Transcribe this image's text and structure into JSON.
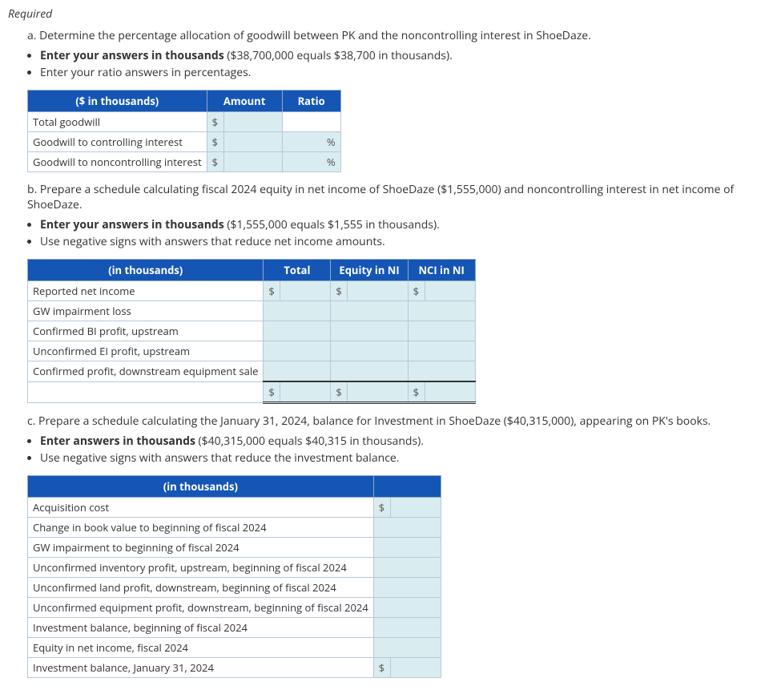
{
  "heading": "Required",
  "parts": {
    "a": {
      "prompt": "a. Determine the percentage allocation of goodwill between PK and the noncontrolling interest in ShoeDaze.",
      "bullets": [
        {
          "bold": "Enter your answers in thousands",
          "rest": " ($38,700,000 equals $38,700 in thousands)."
        },
        {
          "bold": "",
          "rest": "Enter your ratio answers in percentages."
        }
      ],
      "table": {
        "headers": [
          "($ in thousands)",
          "Amount",
          "Ratio"
        ],
        "rows": [
          {
            "label": "Total goodwill",
            "cur": "$",
            "amount": "",
            "ratio": ""
          },
          {
            "label": "Goodwill to controlling interest",
            "cur": "$",
            "amount": "",
            "ratio": "%"
          },
          {
            "label": "Goodwill to noncontrolling interest",
            "cur": "$",
            "amount": "",
            "ratio": "%"
          }
        ]
      }
    },
    "b": {
      "prompt": "b. Prepare a schedule calculating fiscal 2024 equity in net income of ShoeDaze ($1,555,000) and noncontrolling interest in net income of ShoeDaze.",
      "bullets": [
        {
          "bold": "Enter your answers in thousands",
          "rest": " ($1,555,000 equals $1,555 in thousands)."
        },
        {
          "bold": "",
          "rest": "Use negative signs with answers that reduce net income amounts."
        }
      ],
      "table": {
        "headers": [
          "(in thousands)",
          "Total",
          "Equity in NI",
          "NCI in NI"
        ],
        "rows": [
          {
            "label": "Reported net income",
            "c1": "$",
            "c2": "$",
            "c3": "$"
          },
          {
            "label": "GW impairment loss",
            "c1": "",
            "c2": "",
            "c3": ""
          },
          {
            "label": "Confirmed BI profit, upstream",
            "c1": "",
            "c2": "",
            "c3": ""
          },
          {
            "label": "Unconfirmed EI profit, upstream",
            "c1": "",
            "c2": "",
            "c3": ""
          },
          {
            "label": "Confirmed profit, downstream equipment sale",
            "c1": "",
            "c2": "",
            "c3": ""
          }
        ],
        "totals": {
          "label": "",
          "c1": "$",
          "c2": "$",
          "c3": "$"
        }
      }
    },
    "c": {
      "prompt": "c. Prepare a schedule calculating the January 31, 2024, balance for Investment in ShoeDaze ($40,315,000), appearing on PK's books.",
      "bullets": [
        {
          "bold": "Enter answers in thousands",
          "rest": " ($40,315,000 equals $40,315 in thousands)."
        },
        {
          "bold": "",
          "rest": "Use negative signs with answers that reduce the investment balance."
        }
      ],
      "table": {
        "headers": [
          "(in thousands)"
        ],
        "rows": [
          {
            "label": "Acquisition cost",
            "cur": "$"
          },
          {
            "label": "Change in book value to beginning of fiscal 2024",
            "cur": ""
          },
          {
            "label": "GW impairment to beginning of fiscal 2024",
            "cur": ""
          },
          {
            "label": "Unconfirmed inventory profit, upstream, beginning of fiscal 2024",
            "cur": ""
          },
          {
            "label": "Unconfirmed land profit, downstream, beginning of fiscal 2024",
            "cur": ""
          },
          {
            "label": "Unconfirmed equipment profit, downstream, beginning of fiscal 2024",
            "cur": ""
          },
          {
            "label": "Investment balance, beginning of fiscal 2024",
            "cur": ""
          },
          {
            "label": "Equity in net income, fiscal 2024",
            "cur": ""
          },
          {
            "label": "Investment balance, January 31, 2024",
            "cur": "$"
          }
        ]
      }
    }
  }
}
